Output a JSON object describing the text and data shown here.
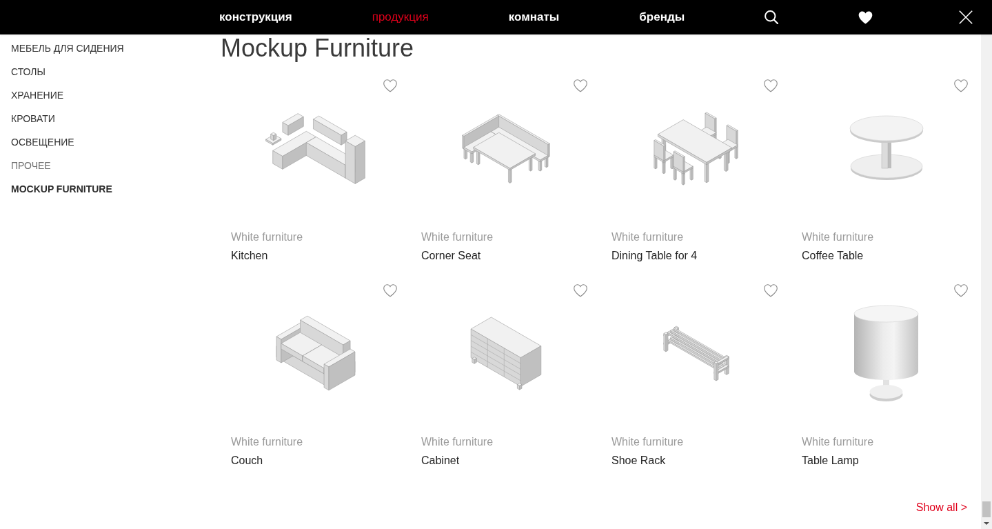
{
  "nav": {
    "items": [
      {
        "label": "конструкция",
        "selected": false
      },
      {
        "label": "продукция",
        "selected": true
      },
      {
        "label": "комнаты",
        "selected": false
      },
      {
        "label": "бренды",
        "selected": false
      }
    ]
  },
  "sidebar": {
    "items": [
      {
        "label": "МЕБЕЛЬ ДЛЯ СИДЕНИЯ",
        "selected": false,
        "dimmed": false
      },
      {
        "label": "СТОЛЫ",
        "selected": false,
        "dimmed": false
      },
      {
        "label": "ХРАНЕНИЕ",
        "selected": false,
        "dimmed": false
      },
      {
        "label": "КРОВАТИ",
        "selected": false,
        "dimmed": false
      },
      {
        "label": "ОСВЕЩЕНИЕ",
        "selected": false,
        "dimmed": false
      },
      {
        "label": "ПРОЧЕЕ",
        "selected": false,
        "dimmed": true
      },
      {
        "label": "MOCKUP FURNITURE",
        "selected": true,
        "dimmed": false
      }
    ]
  },
  "page_title": "Mockup Furniture",
  "products": [
    {
      "kind": "kitchen",
      "category": "White furniture",
      "name": "Kitchen",
      "favorited": false
    },
    {
      "kind": "corner-seat",
      "category": "White furniture",
      "name": "Corner Seat",
      "favorited": false
    },
    {
      "kind": "dining-set",
      "category": "White furniture",
      "name": "Dining Table for 4",
      "favorited": false
    },
    {
      "kind": "round-table",
      "category": "White furniture",
      "name": "Coffee Table",
      "favorited": false
    },
    {
      "kind": "sofa",
      "category": "White furniture",
      "name": "Couch",
      "favorited": false
    },
    {
      "kind": "dresser",
      "category": "White furniture",
      "name": "Cabinet",
      "favorited": false
    },
    {
      "kind": "shoe-rack",
      "category": "White furniture",
      "name": "Shoe Rack",
      "favorited": false
    },
    {
      "kind": "lamp",
      "category": "White furniture",
      "name": "Table Lamp",
      "favorited": false
    }
  ],
  "show_all_link": "Show all >"
}
